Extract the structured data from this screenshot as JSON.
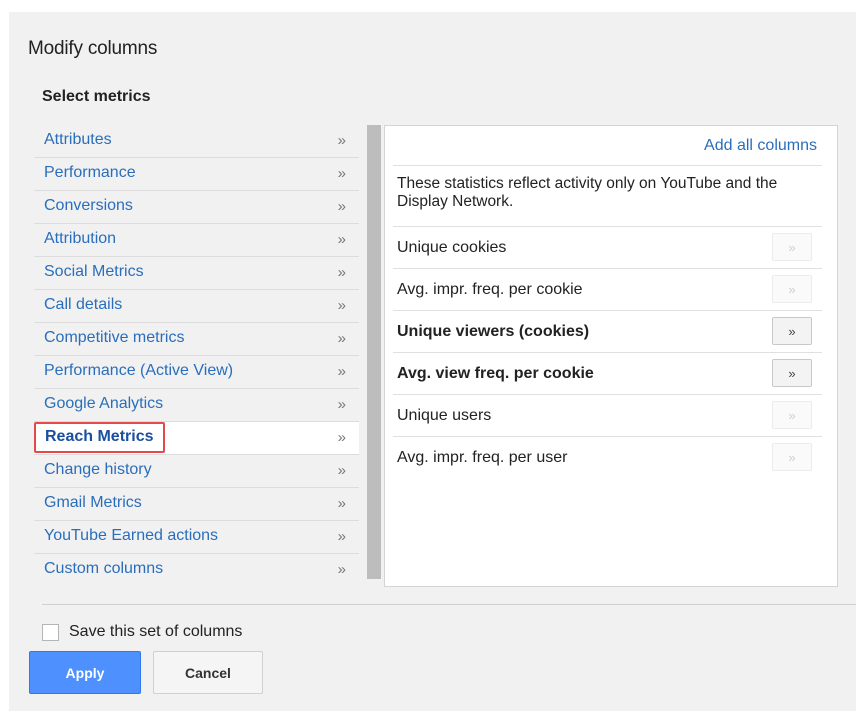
{
  "dialog": {
    "title": "Modify columns",
    "subtitle": "Select metrics"
  },
  "categories": [
    {
      "label": "Attributes",
      "arrow": "»"
    },
    {
      "label": "Performance",
      "arrow": "»"
    },
    {
      "label": "Conversions",
      "arrow": "»"
    },
    {
      "label": "Attribution",
      "arrow": "»"
    },
    {
      "label": "Social Metrics",
      "arrow": "»"
    },
    {
      "label": "Call details",
      "arrow": "»"
    },
    {
      "label": "Competitive metrics",
      "arrow": "»"
    },
    {
      "label": "Performance (Active View)",
      "arrow": "»"
    },
    {
      "label": "Google Analytics",
      "arrow": "»"
    },
    {
      "label": "Reach Metrics",
      "arrow": "»",
      "selected": true
    },
    {
      "label": "Change history",
      "arrow": "»"
    },
    {
      "label": "Gmail Metrics",
      "arrow": "»"
    },
    {
      "label": "YouTube Earned actions",
      "arrow": "»"
    },
    {
      "label": "Custom columns",
      "arrow": "»"
    }
  ],
  "metrics_panel": {
    "add_all_label": "Add all columns",
    "note": "These statistics reflect activity only on YouTube and the Display Network.",
    "items": [
      {
        "label": "Unique cookies",
        "button": "»",
        "active": false
      },
      {
        "label": "Avg. impr. freq. per cookie",
        "button": "»",
        "active": false
      },
      {
        "label": "Unique viewers (cookies)",
        "button": "»",
        "active": true
      },
      {
        "label": "Avg. view freq. per cookie",
        "button": "»",
        "active": true
      },
      {
        "label": "Unique users",
        "button": "»",
        "active": false
      },
      {
        "label": "Avg. impr. freq. per user",
        "button": "»",
        "active": false
      }
    ]
  },
  "footer": {
    "save_label": "Save this set of columns",
    "save_checked": false,
    "apply_label": "Apply",
    "cancel_label": "Cancel"
  },
  "colors": {
    "link": "#2a6ebb",
    "selected_highlight": "#e44a4a",
    "primary_button": "#4d90fe"
  }
}
